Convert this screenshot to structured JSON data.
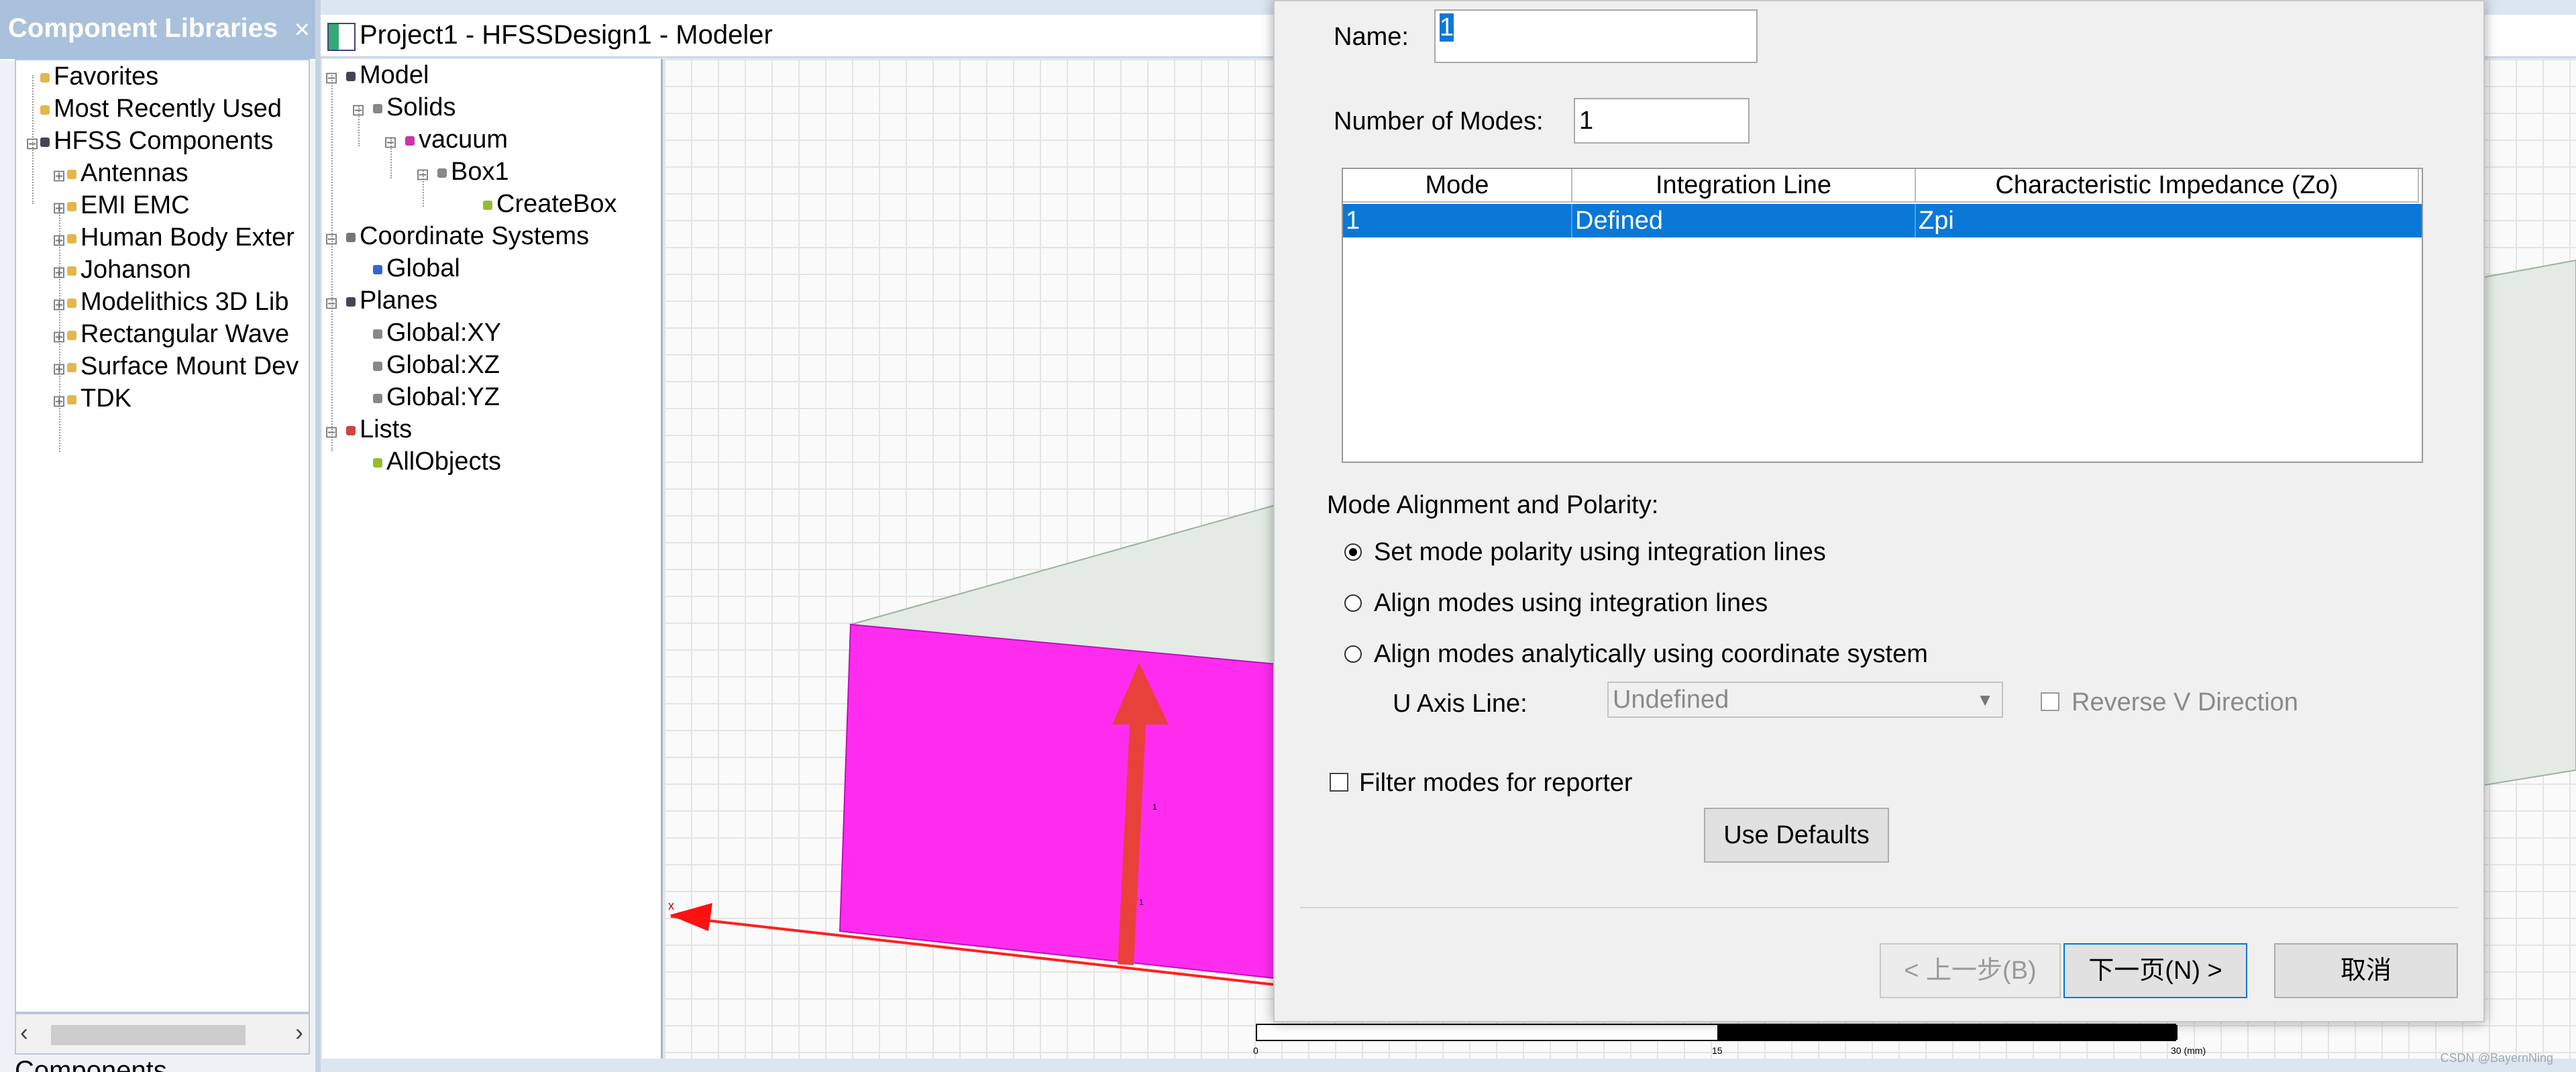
{
  "component_libraries": {
    "title": "Component Libraries",
    "close_glyph": "×",
    "items": [
      {
        "label": "Favorites",
        "level": 0
      },
      {
        "label": "Most Recently Used",
        "level": 0
      },
      {
        "label": "HFSS Components",
        "level": 0
      },
      {
        "label": "Antennas",
        "level": 1
      },
      {
        "label": "EMI EMC",
        "level": 1
      },
      {
        "label": "Human Body Exter",
        "level": 1
      },
      {
        "label": "Johanson",
        "level": 1
      },
      {
        "label": "Modelithics 3D Lib",
        "level": 1
      },
      {
        "label": "Rectangular Wave",
        "level": 1
      },
      {
        "label": "Surface Mount Dev",
        "level": 1
      },
      {
        "label": "TDK",
        "level": 1
      }
    ],
    "bottom_tab": "Components"
  },
  "modeler": {
    "title": "Project1 - HFSSDesign1 - Modeler",
    "tree": [
      {
        "label": "Model",
        "level": 0
      },
      {
        "label": "Solids",
        "level": 1
      },
      {
        "label": "vacuum",
        "level": 2
      },
      {
        "label": "Box1",
        "level": 3
      },
      {
        "label": "CreateBox",
        "level": 4
      },
      {
        "label": "Coordinate Systems",
        "level": 0
      },
      {
        "label": "Global",
        "level": 1
      },
      {
        "label": "Planes",
        "level": 0
      },
      {
        "label": "Global:XY",
        "level": 1
      },
      {
        "label": "Global:XZ",
        "level": 1
      },
      {
        "label": "Global:YZ",
        "level": 1
      },
      {
        "label": "Lists",
        "level": 0
      },
      {
        "label": "AllObjects",
        "level": 1
      }
    ],
    "viewport": {
      "axis_label": "x",
      "port_labels": [
        "1",
        "1"
      ],
      "scale_ticks": [
        "0",
        "15",
        "30 (mm)"
      ],
      "colors": {
        "box_face": "#ff2cf0",
        "arrow": "#e8413a",
        "grid": "#e4e4e4"
      }
    }
  },
  "dialog": {
    "name_label": "Name:",
    "name_value": "1",
    "modes_label": "Number of Modes:",
    "modes_value": "1",
    "table": {
      "headers": [
        "Mode",
        "Integration Line",
        "Characteristic Impedance (Zo)"
      ],
      "rows": [
        [
          "1",
          "Defined",
          "Zpi"
        ]
      ]
    },
    "alignment_title": "Mode Alignment and Polarity:",
    "radios": [
      {
        "label": "Set mode polarity using integration lines",
        "selected": true
      },
      {
        "label": "Align modes using integration lines",
        "selected": false
      },
      {
        "label": "Align modes analytically using coordinate system",
        "selected": false
      }
    ],
    "u_axis_label": "U Axis Line:",
    "u_axis_value": "Undefined",
    "reverse_v_label": "Reverse V Direction",
    "filter_label": "Filter modes for reporter",
    "use_defaults": "Use Defaults",
    "back_button": "< 上一步(B)",
    "next_button": "下一页(N) >",
    "cancel_button": "取消",
    "accent_color": "#0a78d7"
  },
  "watermark": "CSDN @BayernNing"
}
